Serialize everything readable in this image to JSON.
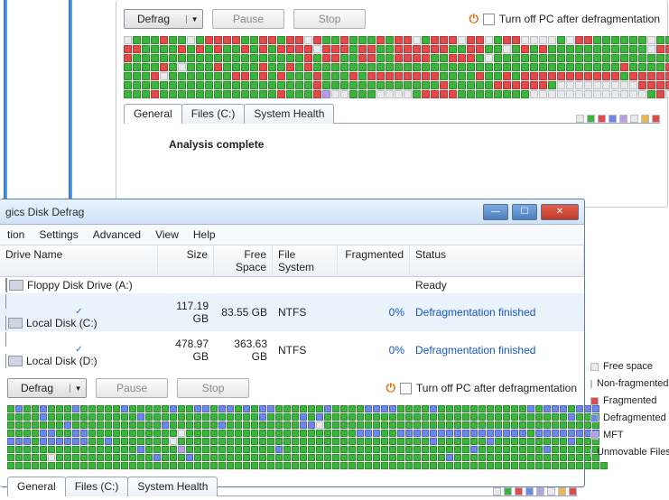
{
  "top_window": {
    "defrag_label": "Defrag",
    "pause_label": "Pause",
    "stop_label": "Stop",
    "turnoff_label": "Turn off PC after defragmentation",
    "tabs": {
      "general": "General",
      "files": "Files (C:)",
      "health": "System Health"
    },
    "analysis_text": "Analysis complete",
    "cluster_rows": [
      "wgggrggwgrrrrggrrgrrwrggrgggrgrrwgrrrwrrwgrrwwwwgwrrggggggwggg",
      "rrggggrgrgrggrgrgrrrrwrrrgrrggrrrrrrggrrggwgrgrgggggggggggwrrr",
      "rgggggggggggggggggggrgrrggrrggrrrrggrrrgwggggggggggggggggggggr",
      "ggggrgwgggrggggrggrgrggggggggggggggggggggggggggggggggggrggggrg",
      "gggrwgggggggrrgrgrgggrgggrgrrrrrrrrggggrggrgrrrrrrrrrrrgrrrrrr",
      "gggggggggggggggggggggrgggggggggggggrgggggrrrrrrgwwwwwwwwwrrrrg",
      "gggrgggggggggggggrgggrvwwgggwwwwgrrrrggggggggwwwwwwwwwwwwwgrww"
    ]
  },
  "second_window": {
    "title": "gics Disk Defrag",
    "menu": {
      "action": "tion",
      "settings": "Settings",
      "advanced": "Advanced",
      "view": "View",
      "help": "Help"
    },
    "columns": {
      "name": "Drive Name",
      "size": "Size",
      "free": "Free Space",
      "fs": "File System",
      "frag": "Fragmented",
      "status": "Status"
    },
    "drives": [
      {
        "checked": false,
        "name": "Floppy Disk Drive (A:)",
        "size": "",
        "free": "",
        "fs": "",
        "frag": "",
        "status": "Ready",
        "selected": false,
        "link": false
      },
      {
        "checked": true,
        "name": "Local Disk (C:)",
        "size": "117.19 GB",
        "free": "83.55 GB",
        "fs": "NTFS",
        "frag": "0%",
        "status": "Defragmentation finished",
        "selected": true,
        "link": true
      },
      {
        "checked": true,
        "name": "Local Disk (D:)",
        "size": "478.97 GB",
        "free": "363.63 GB",
        "fs": "NTFS",
        "frag": "0%",
        "status": "Defragmentation finished",
        "selected": false,
        "link": true
      }
    ],
    "defrag_label": "Defrag",
    "pause_label": "Pause",
    "stop_label": "Stop",
    "turnoff_label": "Turn off PC after defragmentation",
    "tabs": {
      "general": "General",
      "files": "Files (C:)",
      "health": "System Health"
    },
    "cluster_rows": [
      "gbggbgggbgggggbgggggbggbbgbbgbgbbggggggbggggbbbbggggbgggggggggggbgbbbgbbb",
      "ggggbgggggggggggbggggggggggggggbggggbgbggggggggggggggggggggggggggggggbggg",
      "gggggggbgggggggggggbggggggbgggggggggbbwgggggggggggggggggggggggggggggggggg",
      "ggggbbggbbgggggggggggwgggggggggggggggggggggbbbggbbbbbbbbbbbbbbbbgbbbbbbbb",
      "bbbgbbbbbbggbgggggggwgggggggggggggggggggggggggggggggbggggggbgggggggggbggg",
      "ggggggggggggggggbggggvgggggggggggbgggggggggggggggggggggggbggggggggbgggggg",
      "gggggwggggggggggggbgggbgggggggggggggggggggggggggggggggbgggggggggggggggggg",
      "gggggggggggggggggggggggggggggggggggggggggggggggggggggggggggggggggggggggggg"
    ]
  },
  "legend": {
    "free": "Free space",
    "nonfrag": "Non-fragmented",
    "frag": "Fragmented",
    "defrag": "Defragmented",
    "mft": "MFT",
    "unmov": "Unmovable Files"
  },
  "mini_legend_colors": [
    "w",
    "g",
    "r",
    "b",
    "v",
    "w",
    "y",
    "r"
  ]
}
